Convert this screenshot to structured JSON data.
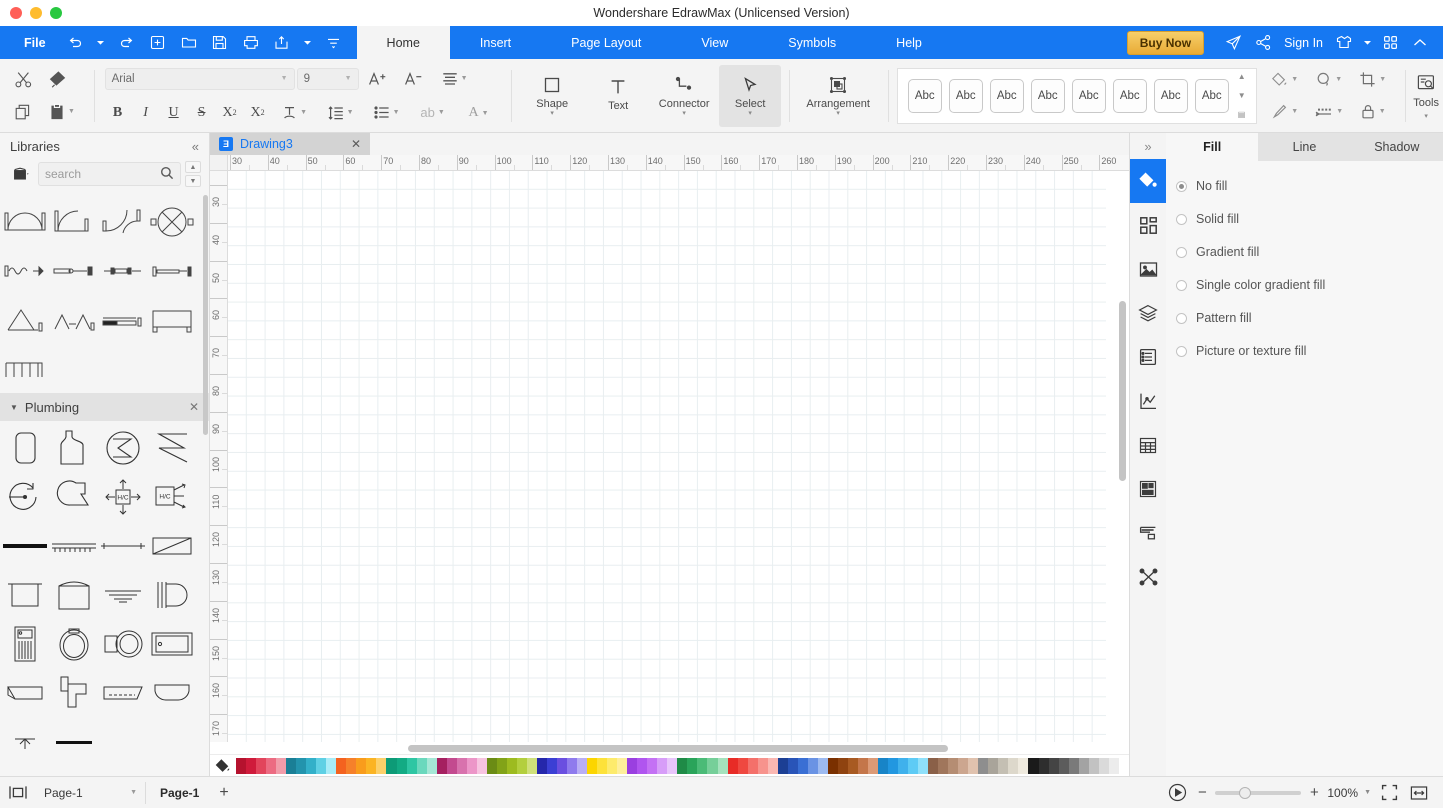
{
  "window": {
    "title": "Wondershare EdrawMax (Unlicensed Version)"
  },
  "menubar": {
    "file_label": "File",
    "quick_access": [
      {
        "name": "undo-icon",
        "label": "Undo"
      },
      {
        "name": "redo-icon",
        "label": "Redo"
      },
      {
        "name": "new-icon",
        "label": "New"
      },
      {
        "name": "open-icon",
        "label": "Open"
      },
      {
        "name": "save-icon",
        "label": "Save"
      },
      {
        "name": "print-icon",
        "label": "Print"
      },
      {
        "name": "export-icon",
        "label": "Export"
      },
      {
        "name": "customize-icon",
        "label": "Customize Quick Access"
      }
    ],
    "tabs": [
      {
        "label": "Home",
        "active": true
      },
      {
        "label": "Insert",
        "active": false
      },
      {
        "label": "Page Layout",
        "active": false
      },
      {
        "label": "View",
        "active": false
      },
      {
        "label": "Symbols",
        "active": false
      },
      {
        "label": "Help",
        "active": false
      }
    ],
    "buy_now": "Buy Now",
    "sign_in": "Sign In",
    "right_icons": [
      "send-icon",
      "share-icon",
      "theme-icon",
      "grid-apps-icon",
      "collapse-ribbon-icon"
    ],
    "accent_color": "#1678f2",
    "buy_now_color": "#e8ab36"
  },
  "ribbon": {
    "clipboard": [
      {
        "name": "cut-icon"
      },
      {
        "name": "format-painter-icon"
      },
      {
        "name": "copy-icon"
      },
      {
        "name": "paste-icon"
      }
    ],
    "font_name": "Arial",
    "font_size": "9",
    "font_buttons_row1": [
      "increase-font-size-icon",
      "decrease-font-size-icon",
      "align-icon"
    ],
    "font_buttons_row2": [
      "bold-icon",
      "italic-icon",
      "underline-icon",
      "strikethrough-icon",
      "superscript-icon",
      "subscript-icon",
      "text-effects-icon",
      "line-spacing-icon",
      "bullet-list-icon",
      "text-wrap-icon",
      "font-color-icon"
    ],
    "bold_label": "B",
    "italic_label": "I",
    "underline_label": "U",
    "strike_label": "S",
    "sup_label": "X",
    "sup_sub": "2",
    "sub_label": "X",
    "sub_sub": "2",
    "abtext_label": "ab",
    "fontcolor_label": "A",
    "tools_group": [
      {
        "label": "Shape",
        "icon": "shape-icon",
        "has_caret": true,
        "selected": false
      },
      {
        "label": "Text",
        "icon": "text-icon",
        "has_caret": false,
        "selected": false
      },
      {
        "label": "Connector",
        "icon": "connector-icon",
        "has_caret": true,
        "selected": false
      },
      {
        "label": "Select",
        "icon": "select-cursor-icon",
        "has_caret": true,
        "selected": true
      },
      {
        "label": "Arrangement",
        "icon": "arrangement-icon",
        "has_caret": true,
        "selected": false
      }
    ],
    "quick_styles": [
      "Abc",
      "Abc",
      "Abc",
      "Abc",
      "Abc",
      "Abc",
      "Abc",
      "Abc"
    ],
    "fmt_icons_row1": [
      "fill-color-icon",
      "shadow-icon",
      "crop-icon"
    ],
    "fmt_icons_row2": [
      "line-color-icon",
      "line-style-icon",
      "lock-icon"
    ],
    "tools_label": "Tools",
    "tools_icon": "tools-icon"
  },
  "libraries": {
    "title": "Libraries",
    "collapse_icon": "collapse-left-icon",
    "library_picker_icon": "library-picker-icon",
    "search": {
      "placeholder": "search",
      "value": "",
      "icon": "search-icon"
    },
    "nav_up_icon": "chevron-up-icon",
    "nav_down_icon": "chevron-down-icon",
    "sections": [
      {
        "name": "doors-windows",
        "title": "",
        "expanded": true,
        "shapes": [
          "double-door",
          "single-door-arc",
          "double-swing-door",
          "revolving-door",
          "folding-door",
          "sliding-door-1",
          "sliding-door-2",
          "pocket-door",
          "window-double-open",
          "window-casement",
          "window-sill",
          "window-bay",
          "window-multi-pane"
        ]
      },
      {
        "name": "plumbing",
        "title": "Plumbing",
        "expanded": true,
        "close_icon": "close-icon",
        "shapes": [
          "tank-cylinder",
          "water-heater",
          "heat-exchanger-circle",
          "heat-exchanger-zigzag",
          "pump-circular",
          "pump-centrifugal",
          "hc-unit-4way",
          "hc-unit-arrows",
          "pipe-solid",
          "pipe-dashed",
          "pipe-thin",
          "duct-diagonal",
          "sink-rect",
          "sink-square",
          "drain-lines",
          "shower-head",
          "water-closet",
          "toilet-round",
          "toilet-oval",
          "bathtub-rect",
          "basin-corner",
          "urinal",
          "tub-angled",
          "basin-oval",
          "floor-drain",
          "pipe-line"
        ]
      }
    ]
  },
  "document": {
    "tab_label": "Drawing3",
    "tab_icon": "edraw-doc-icon",
    "close_icon": "close-icon",
    "hruler_ticks": [
      30,
      40,
      50,
      60,
      70,
      80,
      90,
      100,
      110,
      120,
      130,
      140,
      150,
      160,
      170,
      180,
      190,
      200,
      210,
      220,
      230,
      240,
      250,
      260
    ],
    "vruler_ticks": [
      30,
      40,
      50,
      60,
      70,
      80,
      90,
      100,
      110,
      120,
      130,
      140,
      150,
      160,
      170
    ]
  },
  "palette": {
    "icon": "fill-bucket-icon",
    "colors": [
      "#b5122e",
      "#cf1b3b",
      "#e2445c",
      "#ec6b82",
      "#f19caa",
      "#1a7f96",
      "#2394ad",
      "#33b0c9",
      "#5fd0e4",
      "#a8ecf7",
      "#f4621f",
      "#f6802a",
      "#f99c1c",
      "#fbb424",
      "#fcd06a",
      "#0d9b77",
      "#13ab84",
      "#2ec6a3",
      "#6bd8bd",
      "#a5e7d6",
      "#a52060",
      "#c34a8f",
      "#d872ad",
      "#ec96c8",
      "#f7c3e0",
      "#6b8c15",
      "#82a318",
      "#9dbb20",
      "#b3cf3e",
      "#cfe07a",
      "#2527ab",
      "#3b3fd4",
      "#6a4fe0",
      "#8f7bed",
      "#b9aef5",
      "#fcd500",
      "#fde23a",
      "#fdeb6c",
      "#feef9b",
      "#9a3fe0",
      "#b055ef",
      "#c471f4",
      "#d79df8",
      "#e8c5fb",
      "#1f8b47",
      "#2aa45a",
      "#4bbb77",
      "#76cf99",
      "#a5e2bd",
      "#e82b26",
      "#ef4840",
      "#f4706a",
      "#f7938d",
      "#fab7b2",
      "#1c3f94",
      "#2954b8",
      "#3a6fd4",
      "#6a93e4",
      "#9dbaf0",
      "#7a3000",
      "#8f4310",
      "#a85a22",
      "#c4764a",
      "#dc9a76",
      "#1884c7",
      "#2297e0",
      "#3fb1ec",
      "#5ecbf5",
      "#8fe0fa",
      "#8a6048",
      "#a0765c",
      "#b58d73",
      "#cca68f",
      "#e0c2ae",
      "#8e8e8e",
      "#a9a49a",
      "#c4bfb3",
      "#ddd8cb",
      "#efeade",
      "#1a1a1a",
      "#2e2e2e",
      "#444444",
      "#5c5c5c",
      "#7a7a7a",
      "#a3a3a3",
      "#c2c2c2",
      "#dadada",
      "#ececec",
      "#ffffff"
    ]
  },
  "right_panel": {
    "expand_icon": "chevron-double-right-icon",
    "rail_items": [
      {
        "name": "fill-style-icon",
        "active": true
      },
      {
        "name": "quick-shapes-icon",
        "active": false
      },
      {
        "name": "image-icon",
        "active": false
      },
      {
        "name": "layers-icon",
        "active": false
      },
      {
        "name": "page-list-icon",
        "active": false
      },
      {
        "name": "chart-icon",
        "active": false
      },
      {
        "name": "table-icon",
        "active": false
      },
      {
        "name": "widget-icon",
        "active": false
      },
      {
        "name": "gantt-icon",
        "active": false
      },
      {
        "name": "mindmap-icon",
        "active": false
      }
    ],
    "tabs": [
      {
        "label": "Fill",
        "active": true
      },
      {
        "label": "Line",
        "active": false
      },
      {
        "label": "Shadow",
        "active": false
      }
    ],
    "fill_options": [
      {
        "label": "No fill",
        "selected": true
      },
      {
        "label": "Solid fill",
        "selected": false
      },
      {
        "label": "Gradient fill",
        "selected": false
      },
      {
        "label": "Single color gradient fill",
        "selected": false
      },
      {
        "label": "Pattern fill",
        "selected": false
      },
      {
        "label": "Picture or texture fill",
        "selected": false
      }
    ]
  },
  "statusbar": {
    "view_icon": "page-view-icon",
    "page_select": "Page-1",
    "page_select_caret": "chevron-down-icon",
    "page_tab": "Page-1",
    "add_page_label": "+",
    "play_icon": "presentation-icon",
    "zoom_out": "−",
    "zoom_in": "+",
    "zoom_value": "100%",
    "zoom_caret": "chevron-down-icon",
    "fit_page_icon": "fit-page-icon",
    "fit_width_icon": "fit-width-icon"
  }
}
